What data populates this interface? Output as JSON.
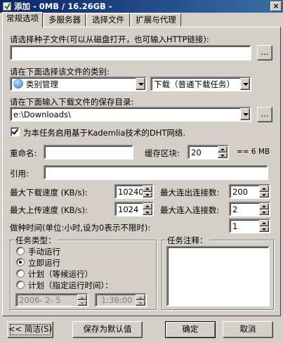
{
  "window": {
    "title": "添加 - 0MB / 16.26GB -",
    "close_glyph": "×"
  },
  "tabs": [
    {
      "label": "常规选项",
      "active": true
    },
    {
      "label": "多服务器"
    },
    {
      "label": "选择文件"
    },
    {
      "label": "扩展与代理"
    }
  ],
  "torrent": {
    "label": "请选择种子文件(可以从磁盘打开，也可输入HTTP链接):",
    "value": "",
    "browse_label": "..."
  },
  "category": {
    "label": "请在下面选择该文件的类别:",
    "selected": "类别管理",
    "type_selected": "下载（普通下载任务）"
  },
  "save_dir": {
    "label": "请在下面输入下载文件的保存目录:",
    "value": "e:\\Downloads\\",
    "browse_label": "..."
  },
  "dht": {
    "label": "为本任务启用基于Kademlia技术的DHT网络.",
    "checked": true
  },
  "rename": {
    "label": "重命名:",
    "value": ""
  },
  "cache": {
    "label": "缓存区块:",
    "value": "20",
    "suffix": "== 6 MB"
  },
  "reference": {
    "label": "引用:",
    "value": ""
  },
  "max_download": {
    "label": "最大下载速度 (KB/s):",
    "value": "10240"
  },
  "max_out_conn": {
    "label": "最大连出连接数:",
    "value": "200"
  },
  "max_upload": {
    "label": "最大上传速度 (KB/s):",
    "value": "1024"
  },
  "max_in_conn": {
    "label": "最大连入连接数:",
    "value": "2"
  },
  "seed_time": {
    "label": "做种时间(单位:小时,设为0表示不限时):",
    "value": "1"
  },
  "task_type": {
    "title": "任务类型：",
    "options": [
      {
        "label": "手动运行",
        "selected": false
      },
      {
        "label": "立即运行",
        "selected": true
      },
      {
        "label": "计划（等候运行）",
        "selected": false
      },
      {
        "label": "计划（指定运行时间）：",
        "selected": false
      }
    ],
    "date_value": "2006- 2- 5",
    "time_value": "1:36:00"
  },
  "task_note": {
    "title": "任务注释：",
    "value": ""
  },
  "buttons": {
    "simple": "<< 简洁(S)",
    "save_default": "保存为默认值",
    "ok": "确定",
    "cancel": "取消"
  }
}
